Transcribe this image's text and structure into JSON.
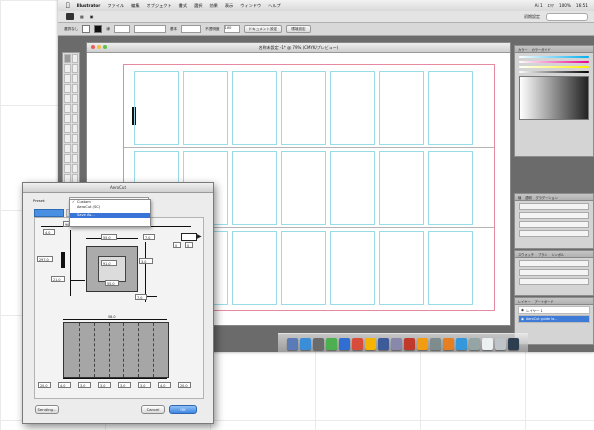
{
  "menubar": {
    "apple": "",
    "app": "Illustrator",
    "items": [
      "ファイル",
      "編集",
      "オブジェクト",
      "書式",
      "選択",
      "効果",
      "表示",
      "ウィンドウ",
      "ヘルプ"
    ],
    "right": [
      "Ai 1",
      "ｴﾘｱ",
      "100%",
      "16:51"
    ]
  },
  "appbar": {
    "workspace": "初期設定"
  },
  "ctrlbar": {
    "selection": "選択なし",
    "stroke_label": "線",
    "style_label": "基本",
    "opacity_label": "不透明度",
    "opacity_value": "100",
    "doc_setup": "ドキュメント設定",
    "preferences": "環境設定"
  },
  "document": {
    "title": "名称未設定 -1* @ 79% (CMYK/プレビュー)"
  },
  "panels": {
    "color_tabs": [
      "カラー",
      "カラーガイド"
    ],
    "stroke_tabs": [
      "線",
      "透明",
      "グラデーション"
    ],
    "swatch_tabs": [
      "スウォッチ",
      "ブラシ",
      "シンボル"
    ],
    "layer_tabs": [
      "レイヤー",
      "アートボード"
    ],
    "layers": [
      "レイヤー 1",
      "AeroCut guide la..."
    ]
  },
  "dialog": {
    "title": "AeroCut",
    "preset_label": "Preset:",
    "dropdown": {
      "items": [
        "Custom",
        "AeroCut (SC)",
        "",
        "Save As..."
      ],
      "checked_index": 0,
      "highlighted_index": 3,
      "check_mark": "✓"
    },
    "fields": {
      "top_width": "90.0",
      "left_margin": "4.0",
      "card_width": "55.0",
      "gutter": "7.0",
      "card_height": "91.0",
      "sheet_height": "297.0",
      "bleed": "3.0",
      "side": "21.0",
      "mid": "55.0",
      "bottom": "7.0",
      "sheet_width": "58.0",
      "small": "0",
      "bottom_values": [
        "20.0",
        "4.0",
        "3.0",
        "3.0",
        "3.0",
        "3.0",
        "4.0",
        "20.0"
      ]
    },
    "buttons": {
      "sending": "Sending...",
      "cancel": "Cancel",
      "ok": "OK"
    }
  }
}
